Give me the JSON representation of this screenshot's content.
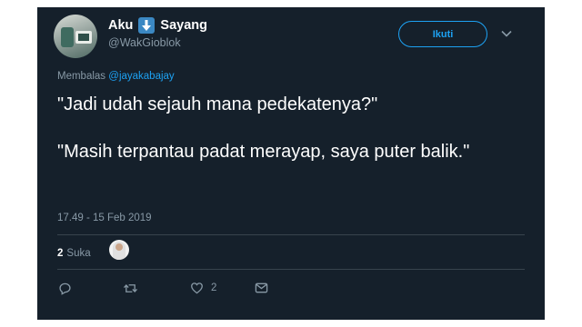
{
  "tweet": {
    "display_name": "Aku",
    "display_name_suffix": "Sayang",
    "handle": "@WakGioblok",
    "follow_label": "Ikuti",
    "reply_prefix": "Membalas",
    "reply_mention": "@jayakabajay",
    "text_line1": "\"Jadi udah sejauh mana pedekatenya?\"",
    "text_line2": "\"Masih terpantau padat merayap, saya puter balik.\"",
    "timestamp": "17.49 - 15 Feb 2019",
    "like_count": "2",
    "like_label": "Suka",
    "action_like_count": "2"
  },
  "icons": {
    "name_emoji": "down-arrow-icon",
    "menu": "chevron-down-icon",
    "reply": "reply-icon",
    "retweet": "retweet-icon",
    "like": "heart-icon",
    "dm": "envelope-icon"
  },
  "colors": {
    "background": "#15202b",
    "accent": "#1da1f2",
    "secondary_text": "#8899a6",
    "divider": "#38444d"
  }
}
